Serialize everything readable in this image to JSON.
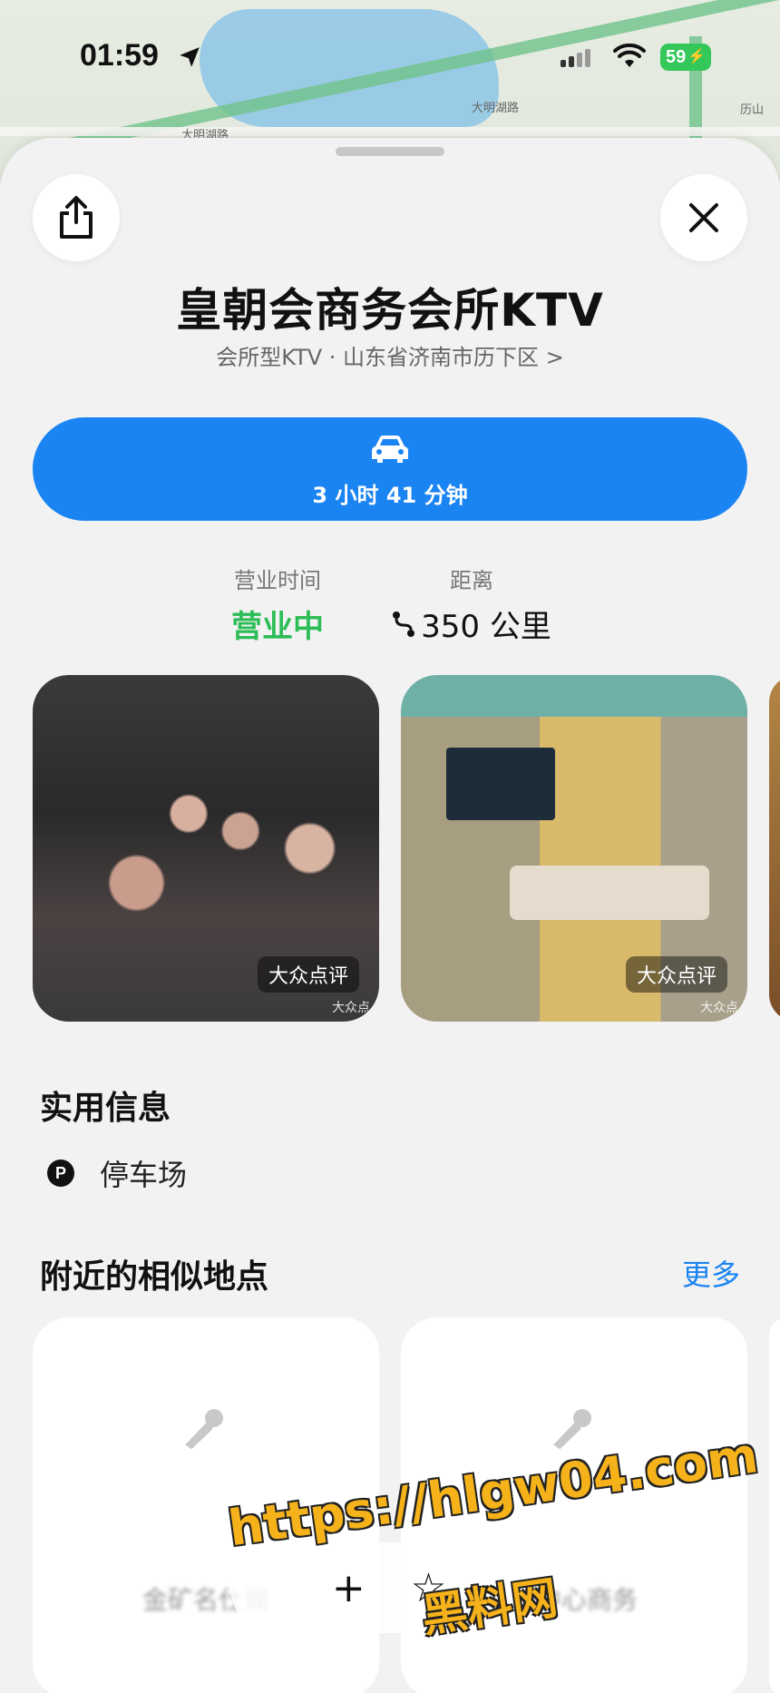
{
  "status_bar": {
    "time": "01:59",
    "battery": "59"
  },
  "map": {
    "labels": [
      "大明湖路",
      "大明湖路",
      "历山"
    ]
  },
  "place": {
    "title": "皇朝会商务会所KTV",
    "subtitle": "会所型KTV · 山东省济南市历下区",
    "subtitle_chevron": ">"
  },
  "directions": {
    "eta": "3 小时 41 分钟"
  },
  "hours": {
    "label": "营业时间",
    "value": "营业中"
  },
  "distance": {
    "label": "距离",
    "value": "350 公里"
  },
  "photos": [
    {
      "badge": "大众点评",
      "watermark": "大众点"
    },
    {
      "badge": "大众点评",
      "watermark": "大众点"
    }
  ],
  "useful_info": {
    "title": "实用信息",
    "parking_icon": "P",
    "parking_label": "停车场"
  },
  "nearby": {
    "title": "附近的相似地点",
    "more": "更多",
    "cards": [
      {
        "name": "金矿名仕娱"
      },
      {
        "name": "员中心商务"
      }
    ]
  },
  "bottom_bar": {
    "favorite_symbol": "☆"
  },
  "watermark": {
    "url": "https://hlgw04.com",
    "name": "黑料网"
  },
  "colors": {
    "accent": "#1a84f3",
    "open_green": "#2dbd57",
    "battery_green": "#34c759"
  }
}
